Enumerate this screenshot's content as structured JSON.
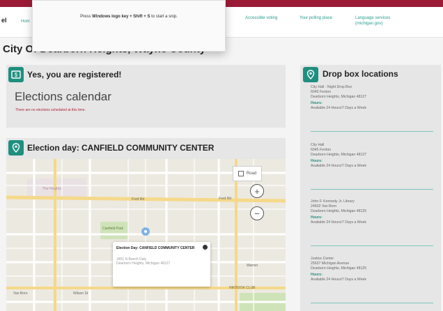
{
  "nav": {
    "logo": "el",
    "items": [
      "Hom",
      "Accessible voting",
      "Your polling place",
      "Language services (michigan.gov)"
    ]
  },
  "snip_tip": {
    "prefix": "Press ",
    "bold": "Windows logo key + Shift + S",
    "suffix": " to start a snip."
  },
  "page_title": "City Of Dearborn Heights, Wayne County",
  "registered": {
    "heading": "Yes, you are registered!"
  },
  "calendar": {
    "title": "Elections calendar",
    "note": "There are no elections scheduled at this time."
  },
  "election_day": {
    "heading": "Election day: CANFIELD COMMUNITY CENTER"
  },
  "map": {
    "road_label": "Road",
    "zoom_in": "+",
    "zoom_out": "−",
    "popup": {
      "title": "Election Day: CANFIELD COMMUNITY CENTER",
      "line1": "1801 N Beech Daly",
      "line2": "Dearborn Heights, Michigan 48127"
    },
    "street_labels": [
      "The Heights",
      "Ford Rd",
      "Ford Rd",
      "Canfield Park",
      "Wilson St",
      "Warren",
      "Van Born",
      "INKBOOK CLUB"
    ]
  },
  "dropbox": {
    "heading": "Drop box locations",
    "hours_label": "Hours:",
    "locations": [
      {
        "name": "City Hall - Night Drop Box",
        "street": "6045 Fenton",
        "city": "Dearborn Heights, Michigan 48127",
        "hours": "Available 24 Hours/7 Days a Week"
      },
      {
        "name": "City Hall",
        "street": "6045 Fenton",
        "city": "Dearborn Heights, Michigan 48127",
        "hours": "Available 24 Hours/7 Days a Week"
      },
      {
        "name": "John F. Kennedy Jr. Library",
        "street": "24602 Van Born",
        "city": "Dearborn Heights, Michigan 48125",
        "hours": "Available 24 Hours/7 Days a Week"
      },
      {
        "name": "Justice Center",
        "street": "25637 Michigan Avenue",
        "city": "Dearborn Heights, Michigan 48125",
        "hours": "Available 24 Hours/7 Days a Week"
      }
    ]
  },
  "colors": {
    "brand": "#9b1b37",
    "teal": "#1f8f7f"
  }
}
